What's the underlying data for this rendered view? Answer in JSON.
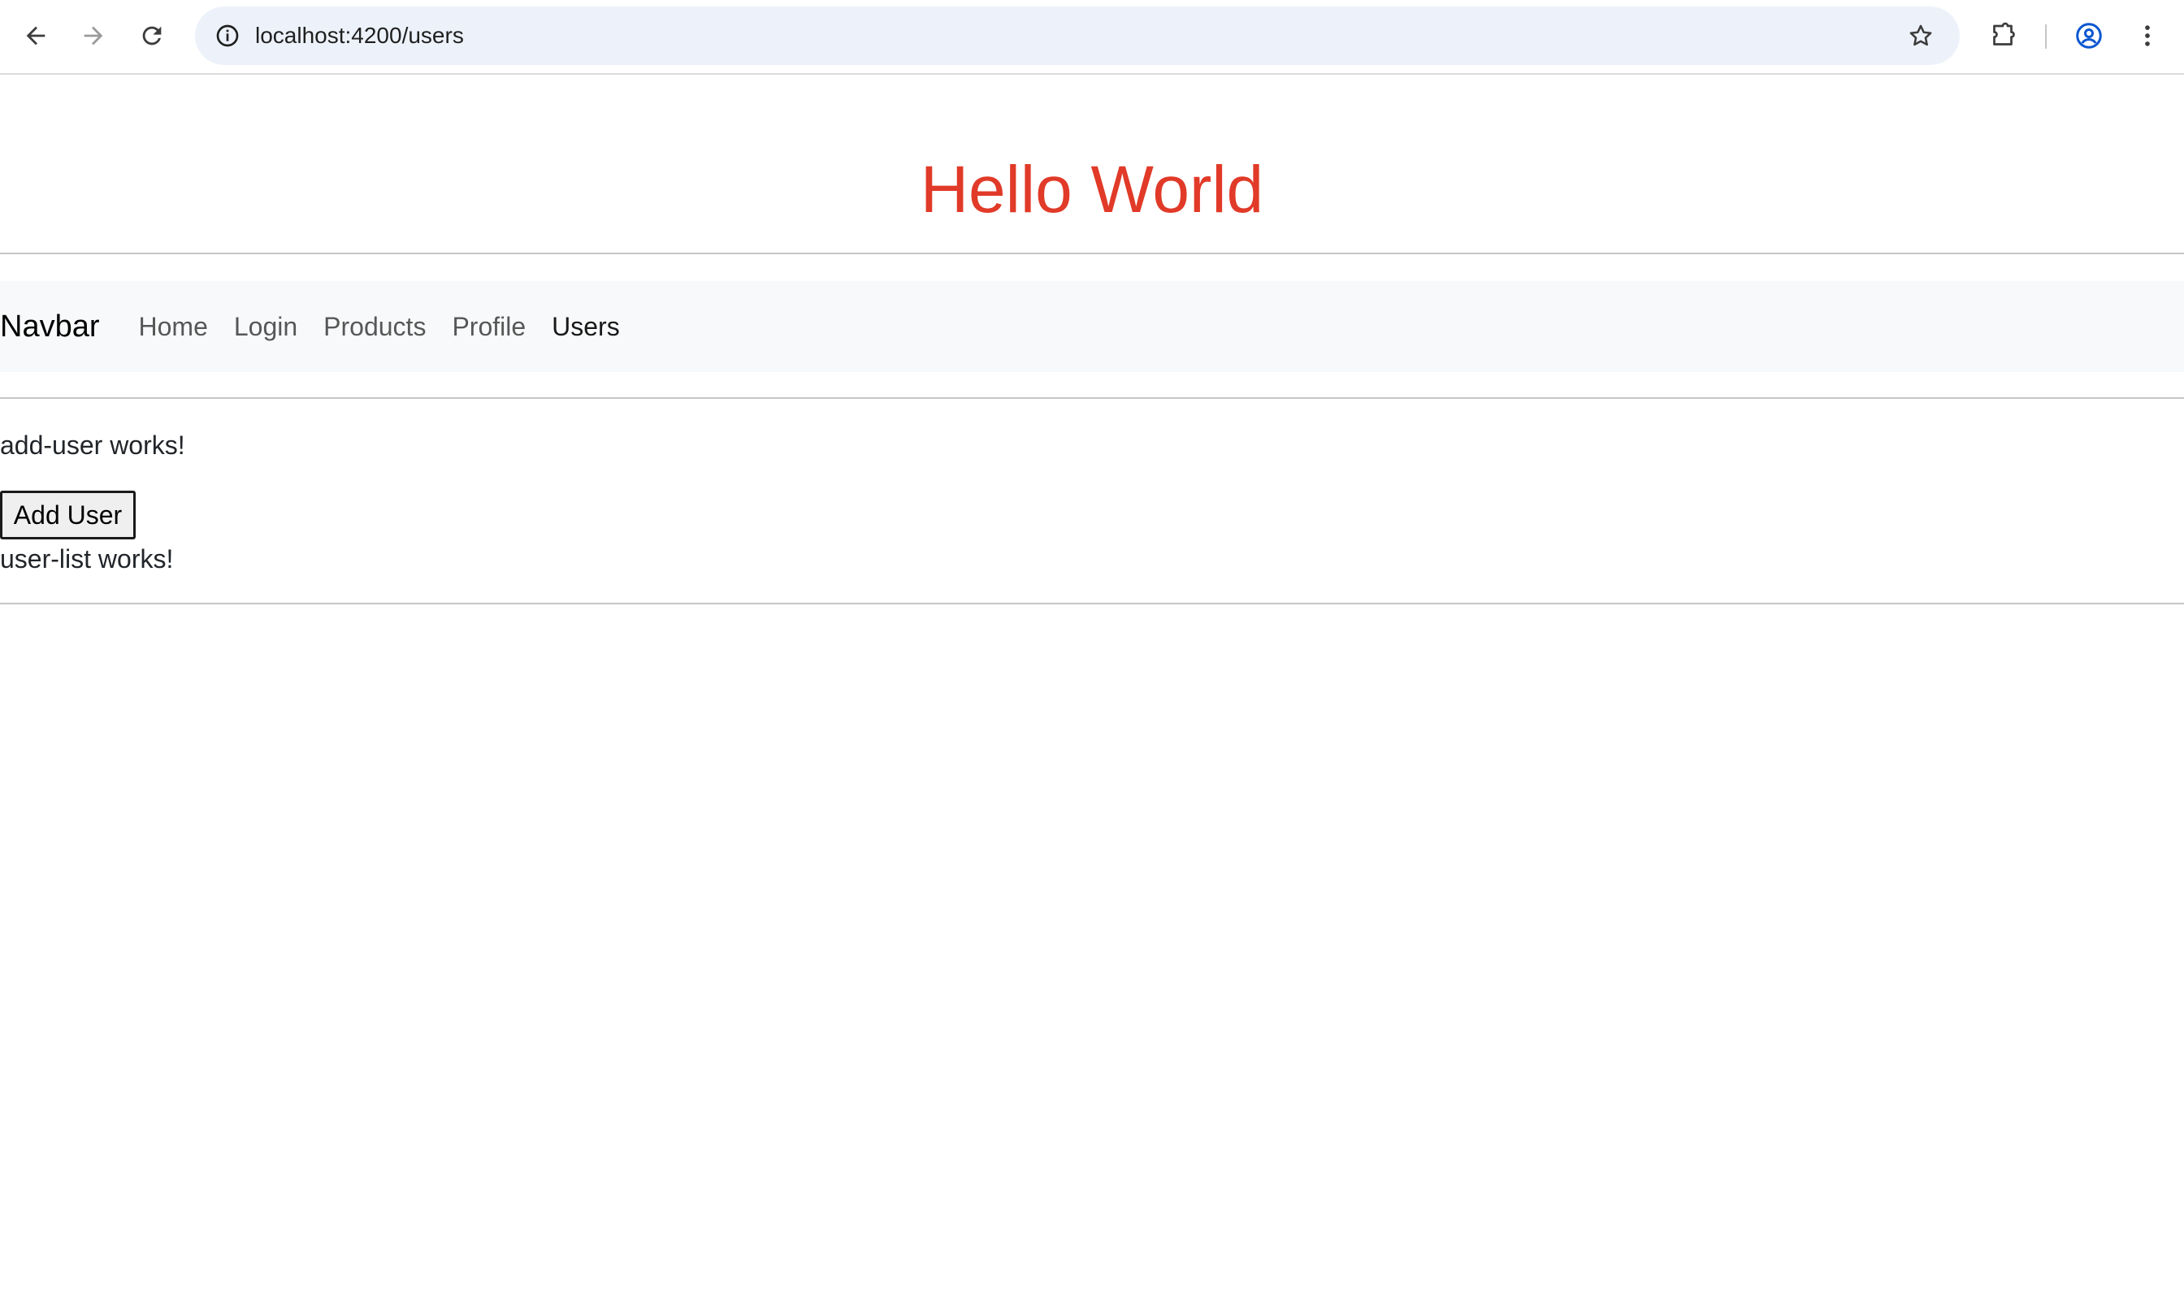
{
  "browser": {
    "url": "localhost:4200/users",
    "icons": {
      "back": "back-arrow-icon",
      "forward": "forward-arrow-icon",
      "reload": "reload-icon",
      "site_info": "info-icon",
      "bookmark": "star-icon",
      "extensions": "puzzle-icon",
      "profile": "profile-icon",
      "menu": "kebab-menu-icon"
    }
  },
  "header": {
    "title": "Hello World",
    "title_color": "#e13a28"
  },
  "navbar": {
    "brand": "Navbar",
    "links": [
      {
        "label": "Home"
      },
      {
        "label": "Login"
      },
      {
        "label": "Products"
      },
      {
        "label": "Profile"
      },
      {
        "label": "Users",
        "active": true
      }
    ]
  },
  "content": {
    "add_user_text": "add-user works!",
    "add_user_button": "Add User",
    "user_list_text": "user-list works!"
  }
}
